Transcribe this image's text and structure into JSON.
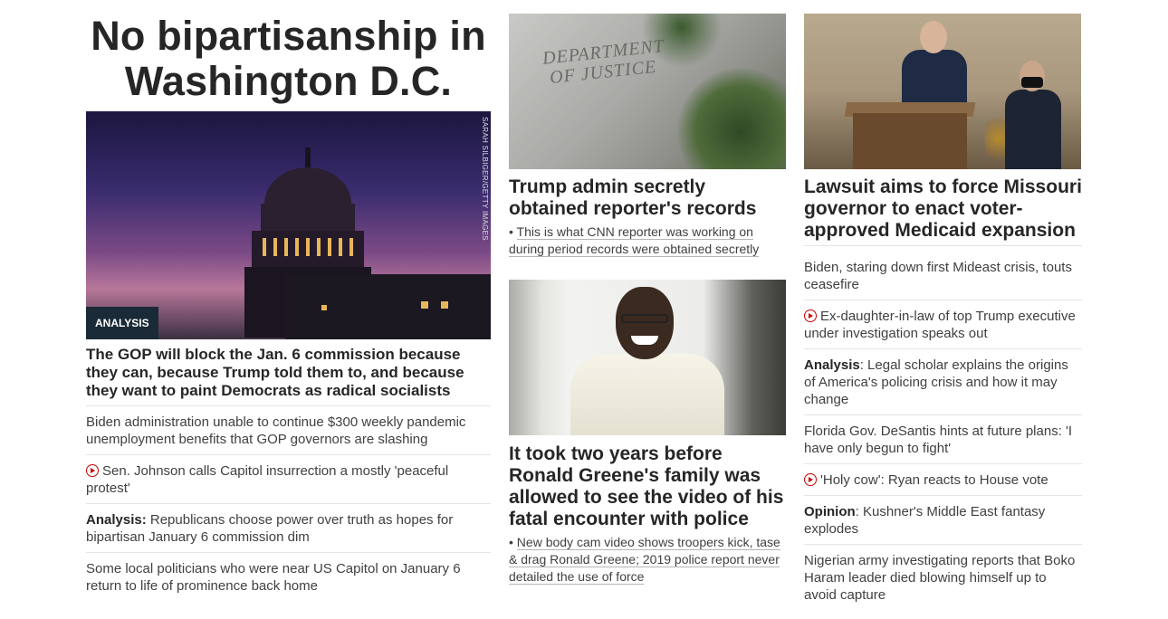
{
  "col1": {
    "headline": "No bipartisanship in Washington D.C.",
    "image_credit": "SARAH SILBIGER/GETTY IMAGES",
    "badge": "ANALYSIS",
    "lead": "The GOP will block the Jan. 6 commission because they can, because Trump told them to, and because they want to paint Democrats as radical socialists",
    "items": [
      {
        "text": "Biden administration unable to continue $300 weekly pandemic unemployment benefits that GOP governors are slashing"
      },
      {
        "text": "Sen. Johnson calls Capitol insurrection a mostly 'peaceful protest'"
      },
      {
        "prefix": "Analysis:",
        "text": " Republicans choose power over truth as hopes for bipartisan January 6 commission dim"
      },
      {
        "text": "Some local politicians who were near US Capitol on January 6 return to life of prominence back home"
      }
    ]
  },
  "col2": {
    "doj_sign": "DEPARTMENT OF JUSTICE",
    "card1_title": "Trump admin secretly obtained reporter's records",
    "card1_link": "This is what CNN reporter was working on during period records were obtained secretly",
    "card2_title": "It took two years before Ronald Greene's family was allowed to see the video of his fatal encounter with police",
    "card2_link": "New body cam video shows troopers kick, tase & drag Ronald Greene; 2019 police report never detailed the use of force"
  },
  "col3": {
    "title": "Lawsuit aims to force Missouri governor to enact voter-approved Medicaid expansion",
    "items": [
      {
        "text": "Biden, staring down first Mideast crisis, touts ceasefire"
      },
      {
        "text": "Ex-daughter-in-law of top Trump executive under investigation speaks out"
      },
      {
        "prefix": "Analysis",
        "text": ": Legal scholar explains the origins of America's policing crisis and how it may change"
      },
      {
        "text": "Florida Gov. DeSantis hints at future plans: 'I have only begun to fight'"
      },
      {
        "text": "'Holy cow': Ryan reacts to House vote"
      },
      {
        "prefix": "Opinion",
        "text": ": Kushner's Middle East fantasy explodes"
      },
      {
        "text": "Nigerian army investigating reports that Boko Haram leader died blowing himself up to avoid capture"
      }
    ]
  },
  "colors": {
    "accent_red": "#cc0000",
    "badge_bg": "#1a2a36",
    "text": "#262626"
  }
}
